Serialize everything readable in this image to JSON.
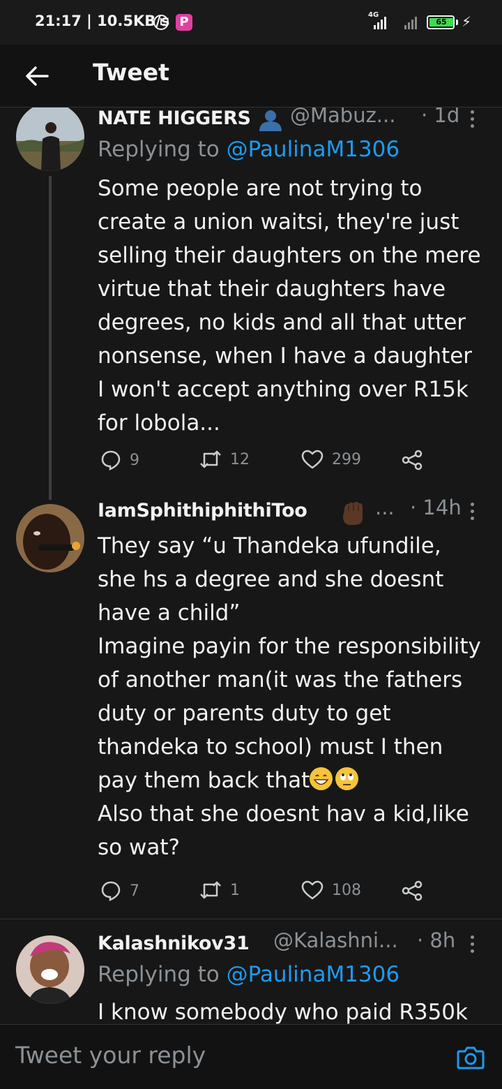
{
  "status_bar": {
    "time": "21:17 | 10.5KB/s",
    "network": "4G",
    "battery": "65",
    "p_badge": "P"
  },
  "header": {
    "title": "Tweet"
  },
  "tweets": [
    {
      "name": "NATE HIGGERS",
      "handle": "@Mabuz...",
      "time": "· 1d",
      "reply_prefix": "Replying to ",
      "reply_to": "@PaulinaM1306",
      "lines": [
        "Some people are not trying to",
        "create a union waitsi, they're just",
        "selling their daughters on the mere",
        "virtue that their daughters have",
        "degrees, no kids and all that utter",
        "nonsense, when I have a daughter",
        "I won't accept anything over R15k",
        "for lobola..."
      ],
      "replies": "9",
      "retweets": "12",
      "likes": "299"
    },
    {
      "name": "IamSphithiphithiToo",
      "handle": "...",
      "time": "· 14h",
      "lines": [
        "They say “u Thandeka ufundile,",
        "she hs a degree and she doesnt",
        "have a child”",
        "Imagine payin for the responsibility",
        "of another man(it was the fathers",
        "duty or parents duty to get",
        "thandeka to school) must I then",
        "pay them back that",
        "Also that she doesnt hav a kid,like",
        "so wat?"
      ],
      "replies": "7",
      "retweets": "1",
      "likes": "108"
    },
    {
      "name": "Kalashnikov31",
      "handle": "@Kalashni...",
      "time": "· 8h",
      "reply_prefix": "Replying to ",
      "reply_to": "@PaulinaM1306",
      "lines": [
        "I know somebody who paid R350k"
      ]
    }
  ],
  "composer": {
    "placeholder": "Tweet your reply"
  },
  "colors": {
    "background": "#171717",
    "text": "#f2f2f2",
    "secondary": "#8b9196",
    "accent": "#1d9bf0",
    "battery": "#3ddc50"
  },
  "icons": [
    "back-arrow-icon",
    "more-icon",
    "reply-icon",
    "retweet-icon",
    "like-icon",
    "share-icon",
    "camera-icon",
    "alarm-icon",
    "signal-icon",
    "battery-icon",
    "charging-icon"
  ]
}
